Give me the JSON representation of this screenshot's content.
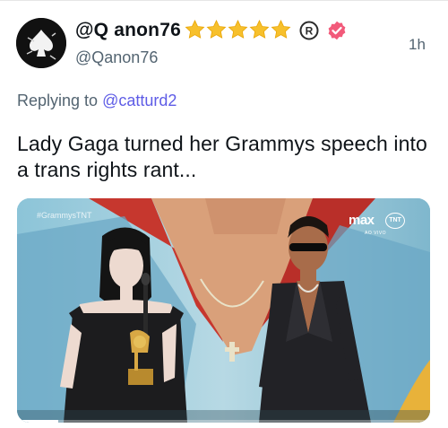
{
  "tweet": {
    "display_name": "@Q anon76",
    "handle": "@Qanon76",
    "timestamp": "1h",
    "replying_prefix": "Replying to",
    "replying_to": "@catturd2",
    "text": "Lady Gaga turned her Grammys speech into a trans rights rant...",
    "badges": [
      "star-icon",
      "star-icon",
      "star-icon",
      "star-icon",
      "star-icon",
      "registered-icon",
      "verified-badge-icon"
    ]
  },
  "media": {
    "overlay_tag": "#GrammysTNT",
    "network_logo": "max",
    "channel_logo": "TNT",
    "live_label": "AO VIVO",
    "progress": 0.1
  },
  "colors": {
    "text_primary": "#0f1419",
    "text_secondary": "#536471",
    "link": "#5e5ce6",
    "star": "#f7c02c",
    "verified": "#f25a7a"
  }
}
